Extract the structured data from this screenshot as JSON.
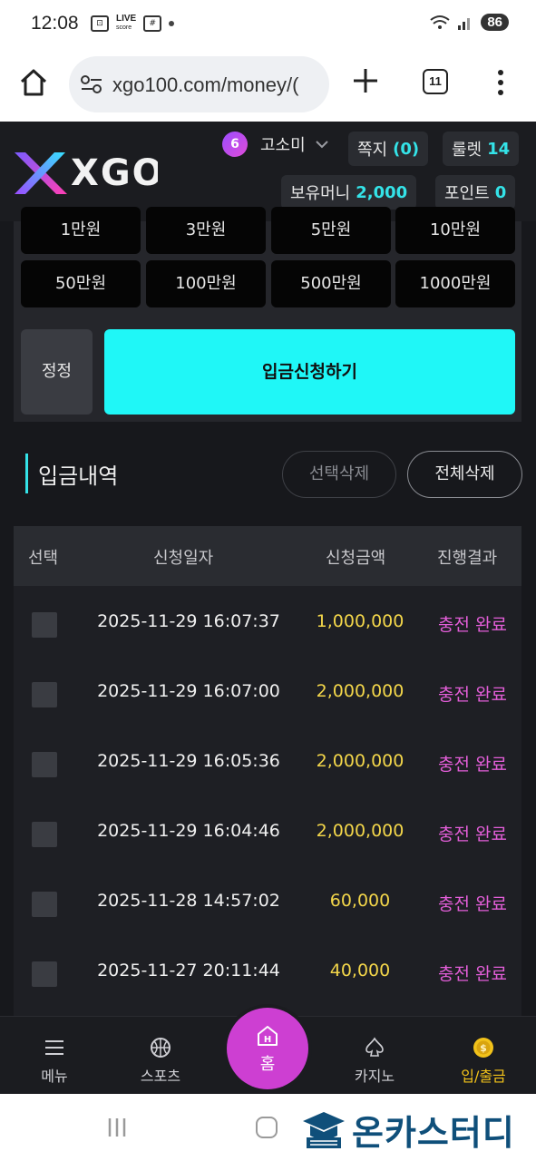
{
  "status_bar": {
    "time": "12:08",
    "live_label": "LIVE",
    "live_sub": "score",
    "battery": "86"
  },
  "browser": {
    "url": "xgo100.com/money/(",
    "tab_count": "11"
  },
  "header": {
    "logo_text": "XGO",
    "level": "6",
    "username": "고소미",
    "message_label": "쪽지",
    "message_count": "(0)",
    "roulette_label": "룰렛",
    "roulette_count": "14",
    "money_label": "보유머니",
    "money_value": "2,000",
    "point_label": "포인트",
    "point_value": "0"
  },
  "amounts": {
    "row1": [
      "1만원",
      "3만원",
      "5만원",
      "10만원"
    ],
    "row2": [
      "50만원",
      "100만원",
      "500만원",
      "1000만원"
    ]
  },
  "actions": {
    "fix_label": "정정",
    "apply_label": "입금신청하기"
  },
  "history": {
    "title": "입금내역",
    "select_delete": "선택삭제",
    "delete_all": "전체삭제",
    "columns": [
      "선택",
      "신청일자",
      "신청금액",
      "진행결과"
    ],
    "rows": [
      {
        "date": "2025-11-29 16:07:37",
        "amount": "1,000,000",
        "result": "충전 완료"
      },
      {
        "date": "2025-11-29 16:07:00",
        "amount": "2,000,000",
        "result": "충전 완료"
      },
      {
        "date": "2025-11-29 16:05:36",
        "amount": "2,000,000",
        "result": "충전 완료"
      },
      {
        "date": "2025-11-29 16:04:46",
        "amount": "2,000,000",
        "result": "충전 완료"
      },
      {
        "date": "2025-11-28 14:57:02",
        "amount": "60,000",
        "result": "충전 완료"
      },
      {
        "date": "2025-11-27 20:11:44",
        "amount": "40,000",
        "result": "충전 완료"
      }
    ]
  },
  "bottom_nav": {
    "menu": "메뉴",
    "sports": "스포츠",
    "home_badge": "H",
    "home": "홈",
    "casino": "카지노",
    "deposit": "입/출금"
  },
  "watermark": "온카스터디",
  "colors": {
    "accent_cyan": "#1ff7f7",
    "amount_yellow": "#f3d64a",
    "result_pink": "#e35ed8",
    "home_magenta": "#cd3fd2",
    "active_gold": "#f2c21a"
  },
  "icons": [
    "home-icon",
    "tune-icon",
    "plus-icon",
    "tabs-icon",
    "more-vert-icon",
    "chevron-down-icon",
    "hamburger-icon",
    "basketball-icon",
    "spade-icon",
    "coin-icon"
  ]
}
